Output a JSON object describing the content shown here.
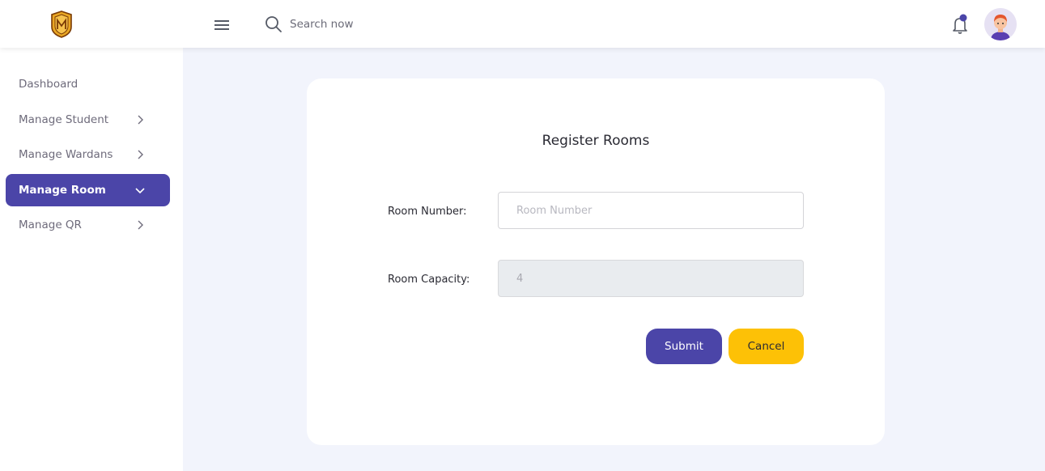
{
  "header": {
    "search_placeholder": "Search now",
    "logo_icon": "crest-logo-icon",
    "menu_icon": "hamburger-icon",
    "search_icon": "search-icon",
    "notification_icon": "bell-icon",
    "notification_dot_color": "#4b45a8"
  },
  "sidebar": {
    "items": [
      {
        "label": "Dashboard",
        "chevron": "none",
        "active": false
      },
      {
        "label": "Manage Student",
        "chevron": "right",
        "active": false
      },
      {
        "label": "Manage Wardans",
        "chevron": "right",
        "active": false
      },
      {
        "label": "Manage Room",
        "chevron": "down",
        "active": true
      },
      {
        "label": "Manage QR",
        "chevron": "right",
        "active": false
      }
    ]
  },
  "form": {
    "title": "Register Rooms",
    "room_number_label": "Room Number:",
    "room_number_placeholder": "Room Number",
    "room_number_value": "",
    "room_capacity_label": "Room Capacity:",
    "room_capacity_value": "4",
    "submit_label": "Submit",
    "cancel_label": "Cancel"
  },
  "colors": {
    "accent": "#4b45a8",
    "cancel": "#fdc106",
    "page_background": "#f2f4fc"
  }
}
